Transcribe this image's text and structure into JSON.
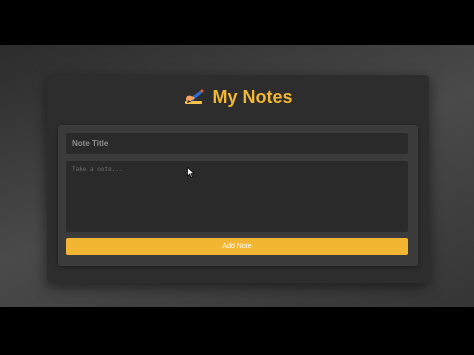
{
  "app": {
    "title": "My Notes",
    "title_icon": "writing-hand-icon",
    "accent_color": "#f2b632"
  },
  "form": {
    "title_placeholder": "Note Title",
    "title_value": "",
    "body_placeholder": "Take a note...",
    "body_value": "",
    "add_button_label": "Add Note"
  }
}
